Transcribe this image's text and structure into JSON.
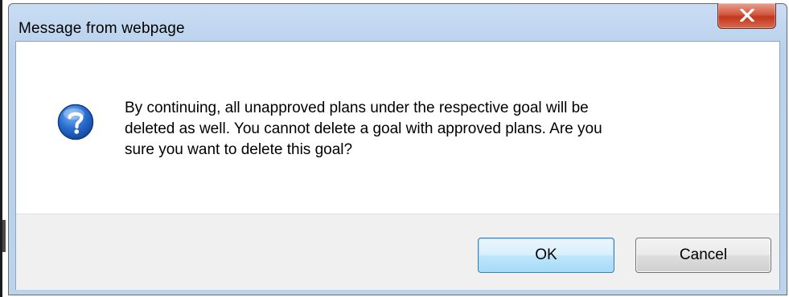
{
  "window": {
    "title": "Message from webpage",
    "close_icon": "close-x-icon"
  },
  "message": {
    "icon": "question-icon",
    "lines": [
      "By continuing, all unapproved plans under the respective goal will be",
      "deleted as well. You cannot delete a goal with approved plans. Are you",
      "sure you want to delete this goal?"
    ]
  },
  "buttons": {
    "ok_label": "OK",
    "cancel_label": "Cancel"
  },
  "colors": {
    "close_button_red": "#c2371c",
    "question_icon_blue": "#1f5fbf",
    "ok_button_border": "#3c7fb1"
  }
}
